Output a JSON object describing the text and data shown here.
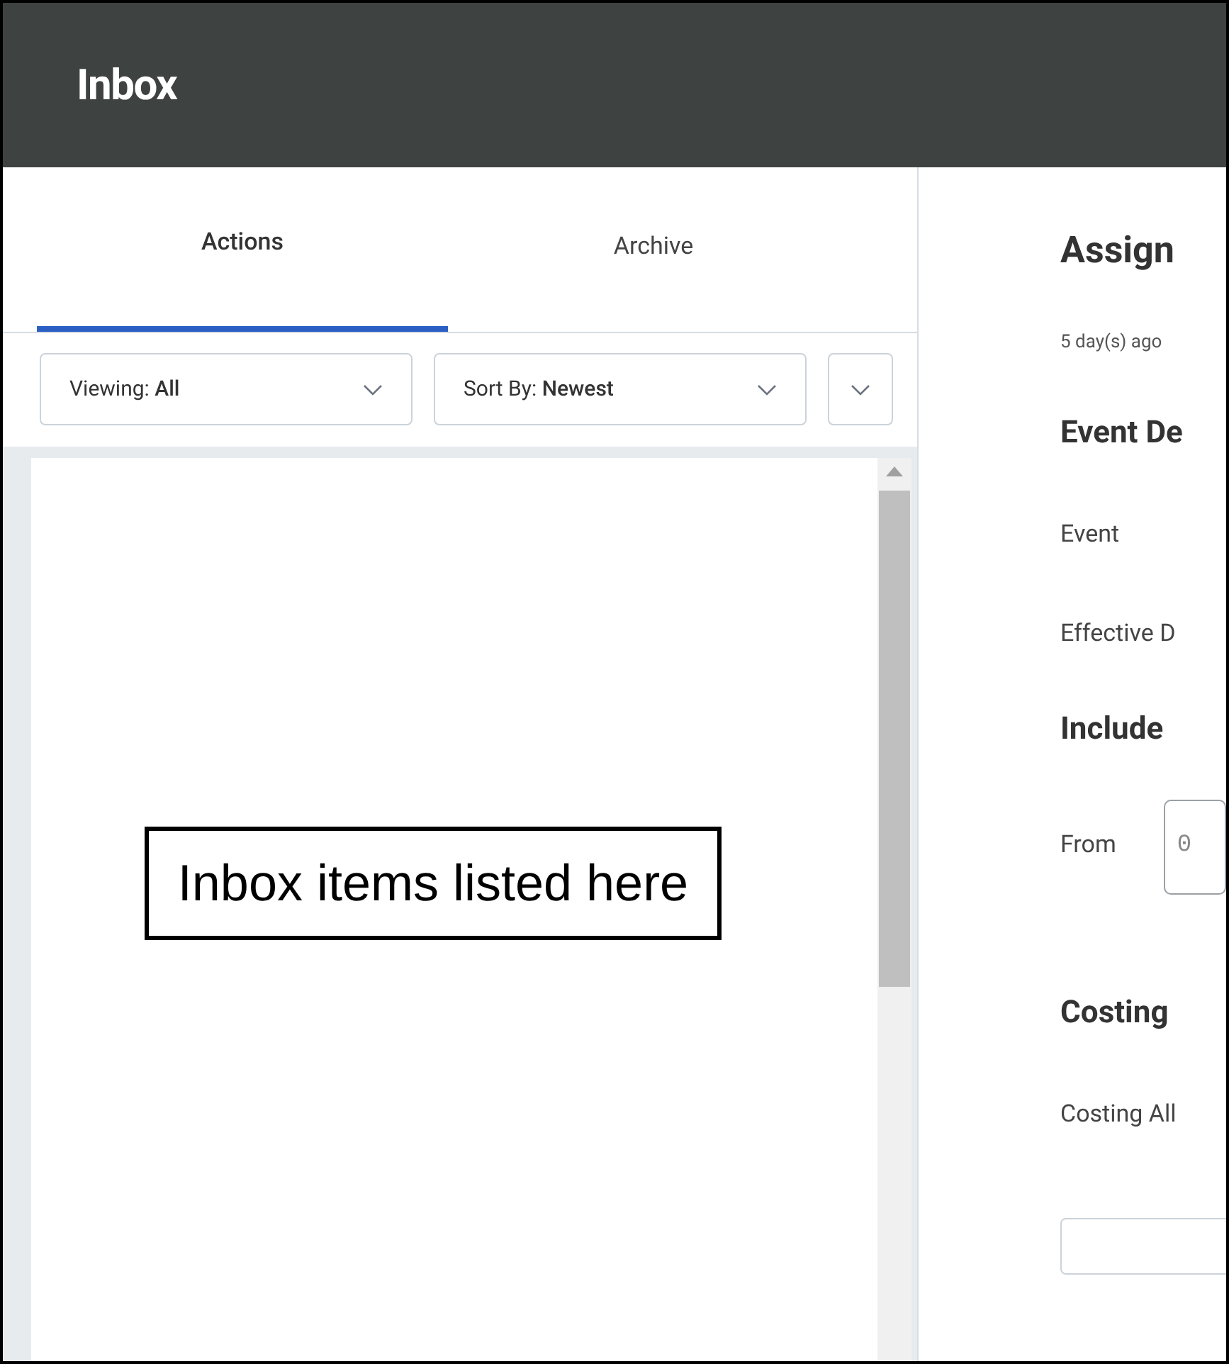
{
  "header": {
    "title": "Inbox"
  },
  "tabs": [
    {
      "label": "Actions",
      "selected": true
    },
    {
      "label": "Archive",
      "selected": false
    }
  ],
  "filters": [
    {
      "label": "Viewing:",
      "value": "All"
    },
    {
      "label": "Sort By:",
      "value": "Newest"
    }
  ],
  "list": {
    "callout": "Inbox items listed here"
  },
  "detail": {
    "title": "Assign",
    "age": "5 day(s) ago",
    "sections": [
      {
        "heading": "Event De",
        "fields": [
          {
            "label": "Event"
          },
          {
            "label": "Effective D"
          }
        ]
      },
      {
        "heading": "Include",
        "fields": [
          {
            "label": "From",
            "value": "0"
          }
        ]
      },
      {
        "heading": "Costing",
        "fields": [
          {
            "label": "Costing All"
          }
        ]
      }
    ]
  }
}
